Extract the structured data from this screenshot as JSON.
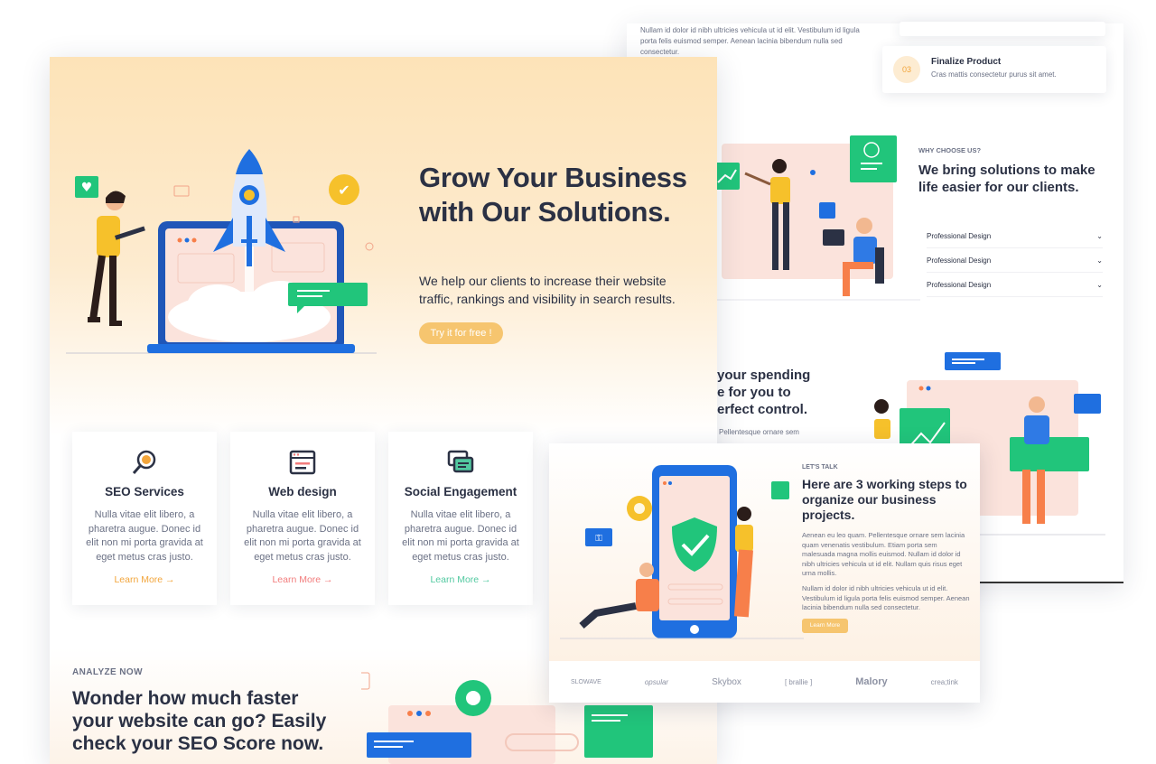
{
  "right_page": {
    "top_paragraph": "Nullam id dolor id nibh ultricies vehicula ut id elit. Vestibulum id ligula porta felis euismod semper. Aenean lacinia bibendum nulla sed consectetur.",
    "step": {
      "number": "03",
      "title": "Finalize Product",
      "text": "Cras mattis consectetur purus sit amet."
    },
    "why_eyebrow": "WHY CHOOSE US?",
    "why_title": "We bring solutions to make life easier for our clients.",
    "accordion": [
      {
        "label": "Professional Design"
      },
      {
        "label": "Professional Design"
      },
      {
        "label": "Professional Design"
      }
    ],
    "spending_lines": [
      "your spending",
      "e for you to",
      "erfect control."
    ],
    "spending_text": "Pellentesque ornare sem"
  },
  "hero": {
    "title": "Grow Your Business with Our Solutions.",
    "subtitle": "We help our clients to increase their website traffic, rankings and visibility in search results.",
    "cta": "Try it for free !"
  },
  "services": [
    {
      "title": "SEO Services",
      "text": "Nulla vitae elit libero, a pharetra augue. Donec id elit non mi porta gravida at eget metus cras justo.",
      "link": "Learn More →",
      "icon": "search-icon",
      "accent": "#f2a53b"
    },
    {
      "title": "Web design",
      "text": "Nulla vitae elit libero, a pharetra augue. Donec id elit non mi porta gravida at eget metus cras justo.",
      "link": "Learn More →",
      "icon": "browser-icon",
      "accent": "#f27c7c"
    },
    {
      "title": "Social Engagement",
      "text": "Nulla vitae elit libero, a pharetra augue. Donec id elit non mi porta gravida at eget metus cras justo.",
      "link": "Learn More →",
      "icon": "chat-icon",
      "accent": "#52c9a0"
    }
  ],
  "analyze": {
    "eyebrow": "ANALYZE NOW",
    "title": "Wonder how much faster your website can go? Easily check your SEO Score now."
  },
  "talk": {
    "eyebrow": "LET'S TALK",
    "title": "Here are 3 working steps to organize our business projects.",
    "p1": "Aenean eu leo quam. Pellentesque ornare sem lacinia quam venenatis vestibulum. Etiam porta sem malesuada magna mollis euismod. Nullam id dolor id nibh ultricies vehicula ut id elit. Nullam quis risus eget urna mollis.",
    "p2": "Nullam id dolor id nibh ultricies vehicula ut id elit. Vestibulum id ligula porta felis euismod semper. Aenean lacinia bibendum nulla sed consectetur.",
    "button": "Learn More",
    "logos": [
      "SLOWAVE",
      "opsular",
      "Skybox",
      "[ brallie ]",
      "Malory",
      "crea;tink"
    ]
  },
  "colors": {
    "accent_orange": "#f6c56f",
    "primary_blue": "#1f6fe0",
    "green": "#21c57b",
    "dark_text": "#2b3144"
  }
}
